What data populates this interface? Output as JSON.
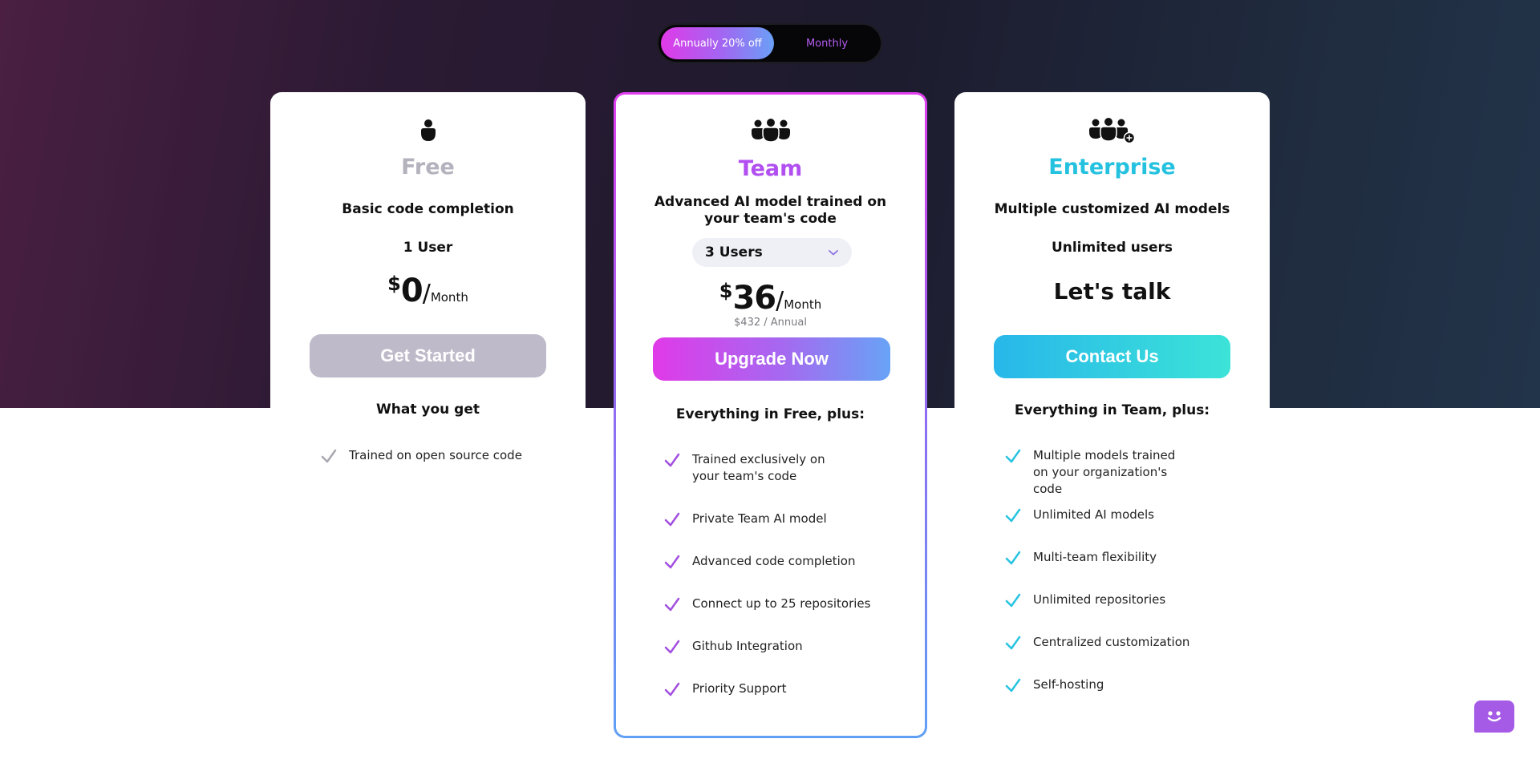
{
  "billing_toggle": {
    "annual_label": "Annually 20% off",
    "monthly_label": "Monthly"
  },
  "plans": {
    "free": {
      "name": "Free",
      "description": "Basic code completion",
      "users": "1 User",
      "currency": "$",
      "price": "0",
      "slash": "/",
      "period": "Month",
      "button": "Get Started",
      "features_heading": "What you get",
      "features": [
        "Trained on open source code"
      ]
    },
    "team": {
      "name": "Team",
      "description": "Advanced AI model trained on your team's code",
      "users_selected": "3 Users",
      "currency": "$",
      "price": "36",
      "slash": "/",
      "period": "Month",
      "annual_note": "$432 / Annual",
      "button": "Upgrade Now",
      "features_heading": "Everything in Free, plus:",
      "features": [
        "Trained exclusively on your team's code",
        "Private Team AI model",
        "Advanced code completion",
        "Connect up to 25 repositories",
        "Github Integration",
        "Priority Support"
      ]
    },
    "enterprise": {
      "name": "Enterprise",
      "description": "Multiple customized AI models",
      "users": "Unlimited users",
      "price_text": "Let's talk",
      "button": "Contact Us",
      "features_heading": "Everything in Team, plus:",
      "features": [
        "Multiple models trained on your organization's code",
        "Unlimited AI models",
        "Multi-team flexibility",
        "Unlimited repositories",
        "Centralized customization",
        "Self-hosting"
      ]
    }
  },
  "colors": {
    "free_check": "#a8a8b0",
    "team_check": "#a24fe0",
    "enterprise_check": "#27c3e0"
  }
}
